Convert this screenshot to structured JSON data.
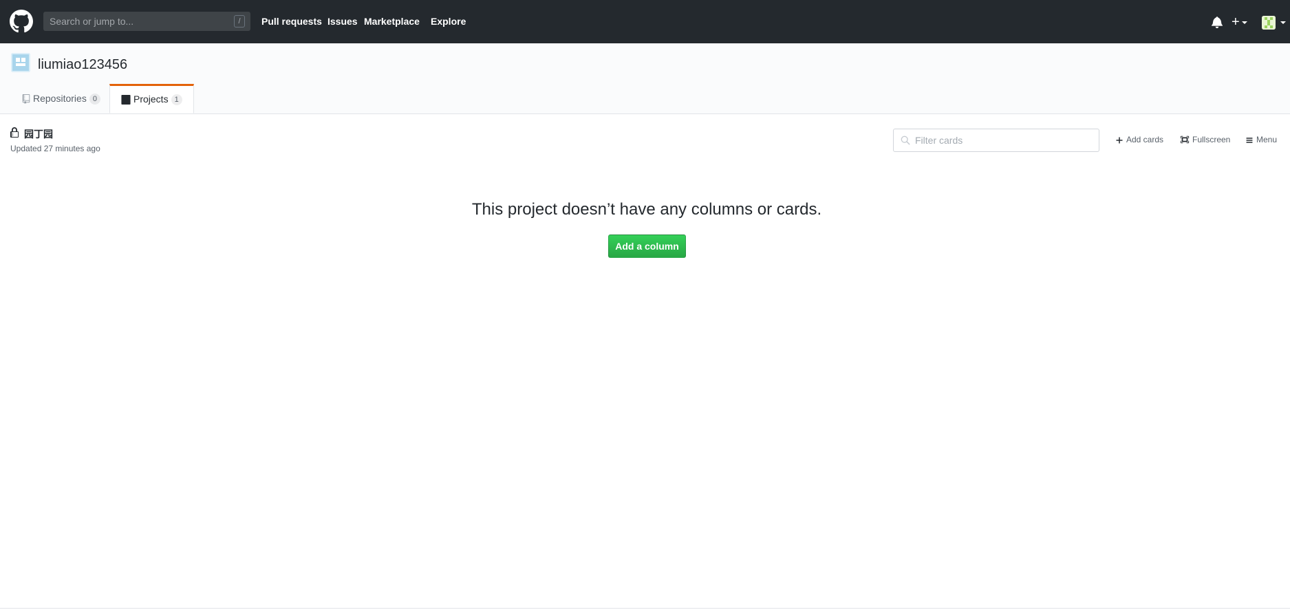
{
  "topbar": {
    "search_placeholder": "Search or jump to...",
    "search_shortcut": "/",
    "nav": [
      "Pull requests",
      "Issues",
      "Marketplace",
      "Explore"
    ],
    "plus": "+"
  },
  "pagehead": {
    "org_name": "liumiao123456",
    "tabs": [
      {
        "label": "Repositories",
        "count": "0",
        "selected": false
      },
      {
        "label": "Projects",
        "count": "1",
        "selected": true
      }
    ]
  },
  "project": {
    "title": "园丁园",
    "updated": "Updated 27 minutes ago",
    "filter_placeholder": "Filter cards",
    "actions": [
      "Add cards",
      "Fullscreen",
      "Menu"
    ]
  },
  "blankslate": {
    "message": "This project doesn’t have any columns or cards.",
    "button": "Add a column"
  },
  "colors": {
    "header_bg": "#24292e",
    "tab_accent": "#e36209",
    "primary_button": "#28a745"
  }
}
